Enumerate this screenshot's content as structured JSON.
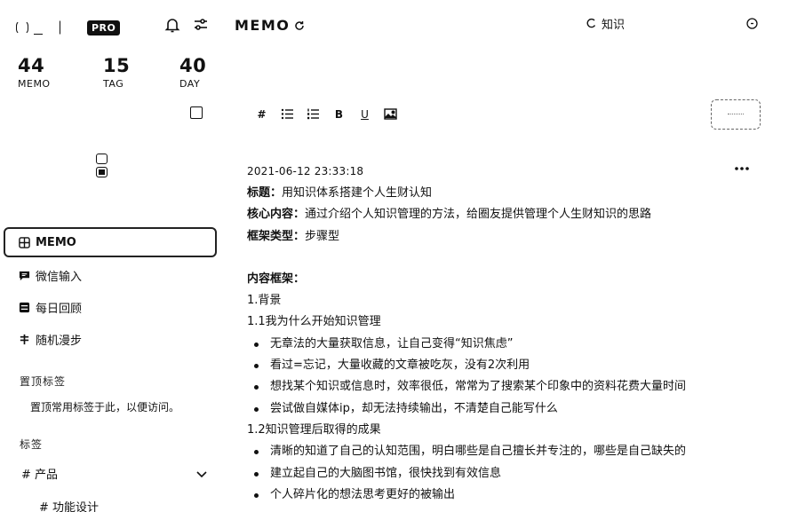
{
  "sidebar": {
    "pro_badge": "PRO",
    "stats": [
      {
        "value": "44",
        "label": "MEMO"
      },
      {
        "value": "15",
        "label": "TAG"
      },
      {
        "value": "40",
        "label": "DAY"
      }
    ],
    "nav": [
      {
        "label": "MEMO",
        "icon": "grid-icon"
      },
      {
        "label": "微信输入",
        "icon": "chat-icon"
      },
      {
        "label": "每日回顾",
        "icon": "review-icon"
      },
      {
        "label": "随机漫步",
        "icon": "shuffle-icon"
      }
    ],
    "pinned_title": "置顶标签",
    "pinned_hint": "置顶常用标签于此，以便访问。",
    "tags_title": "标签",
    "tags": [
      {
        "label": "# 产品"
      },
      {
        "label": "# 功能设计"
      }
    ]
  },
  "main": {
    "title": "MEMO",
    "search": {
      "value": "知识"
    },
    "toolbar": {
      "hash": "#",
      "bold": "B",
      "underline": "U"
    },
    "memo": {
      "timestamp": "2021-06-12 23:33:18",
      "lines": {
        "title_key": "标题：",
        "title_val": "用知识体系搭建个人生财认知",
        "core_key": "核心内容：",
        "core_val": "通过介绍个人知识管理的方法，给圈友提供管理个人生财知识的思路",
        "type_key": "框架类型：",
        "type_val": "步骤型",
        "framework_key": "内容框架：",
        "h1": "1.背景",
        "h11": "1.1我为什么开始知识管理",
        "b11": [
          "无章法的大量获取信息，让自己变得“知识焦虑”",
          "看过=忘记，大量收藏的文章被吃灰，没有2次利用",
          "想找某个知识或信息时，效率很低，常常为了搜索某个印象中的资料花费大量时间",
          "尝试做自媒体ip，却无法持续输出，不清楚自己能写什么"
        ],
        "h12": "1.2知识管理后取得的成果",
        "b12": [
          "清晰的知道了自己的认知范围，明白哪些是自己擅长并专注的，哪些是自己缺失的",
          "建立起自己的大脑图书馆，很快找到有效信息",
          "个人碎片化的想法思考更好的被输出"
        ]
      }
    }
  }
}
